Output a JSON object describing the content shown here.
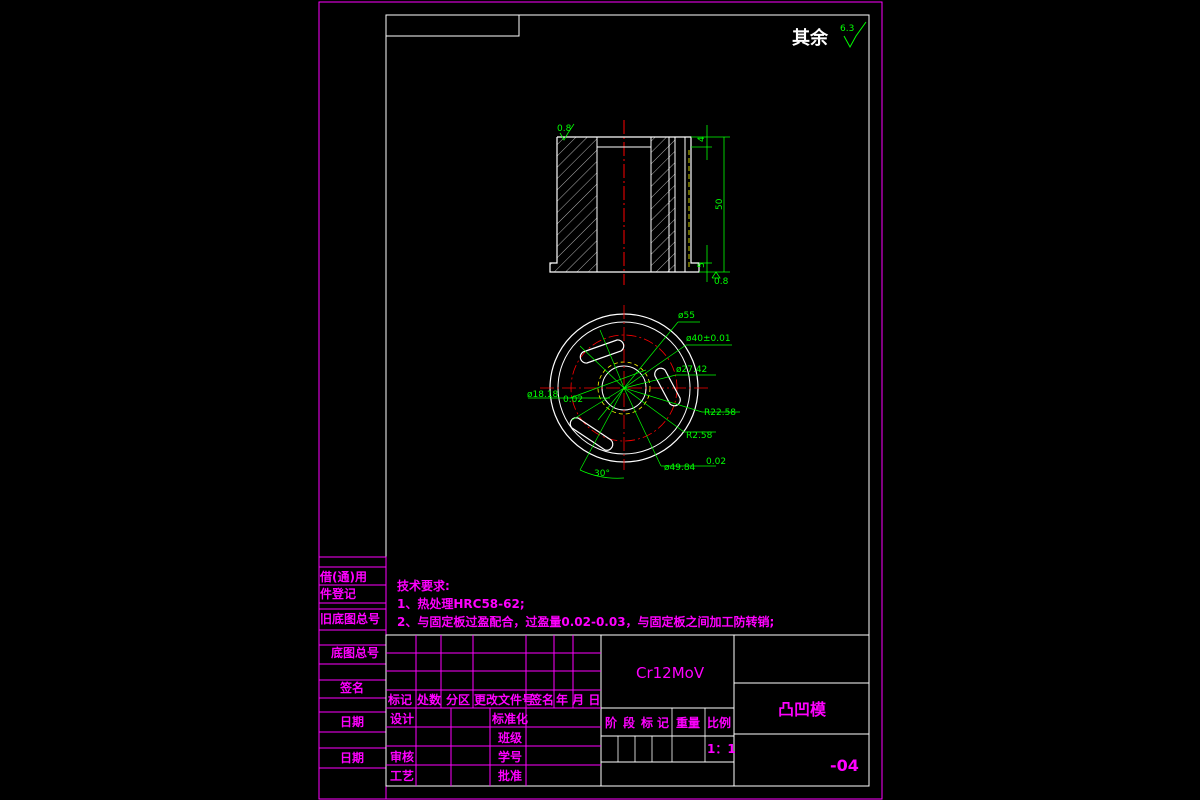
{
  "drawing": {
    "surface_note": {
      "text": "其余",
      "value": "6.3"
    },
    "tech_requirements": {
      "heading": "技术要求:",
      "items": [
        "1、热处理HRC58-62;",
        "2、与固定板过盈配合，过盈量0.02-0.03，与固定板之间加工防转销;"
      ]
    },
    "section_view": {
      "roughness_top": "0.8",
      "roughness_bottom": "0.8",
      "dims": [
        "4",
        "50",
        "5"
      ]
    },
    "plan_view": {
      "dims": [
        "ø55",
        "ø40±0.01",
        "ø27.42",
        "ø18.18",
        "0.02",
        "R22.58",
        "R2.58",
        "ø49.84",
        "0.02",
        "30°"
      ]
    },
    "left_strip": [
      "借(通)用",
      "件登记",
      "旧底图总号",
      "底图总号",
      "签名",
      "日期",
      "日期"
    ],
    "title_block": {
      "material": "Cr12MoV",
      "part_name": "凸凹模",
      "drawing_no": "-04",
      "rev_header": [
        "标记",
        "处数",
        "分区",
        "更改文件号",
        "签名",
        "年 月 日"
      ],
      "design": "设计",
      "standardize": "标准化",
      "check": "审核",
      "process": "工艺",
      "grade": "班级",
      "student_no": "学号",
      "approve": "批准",
      "stage": [
        "阶",
        "段",
        "标",
        "记"
      ],
      "weight": "重量",
      "scale_label": "比例",
      "scale": "1：1"
    },
    "colors": {
      "frame": "#ff00ff",
      "outline": "#ffffff",
      "dim": "#00ff00",
      "center": "#ff0000",
      "hidden": "#ffff00"
    }
  }
}
